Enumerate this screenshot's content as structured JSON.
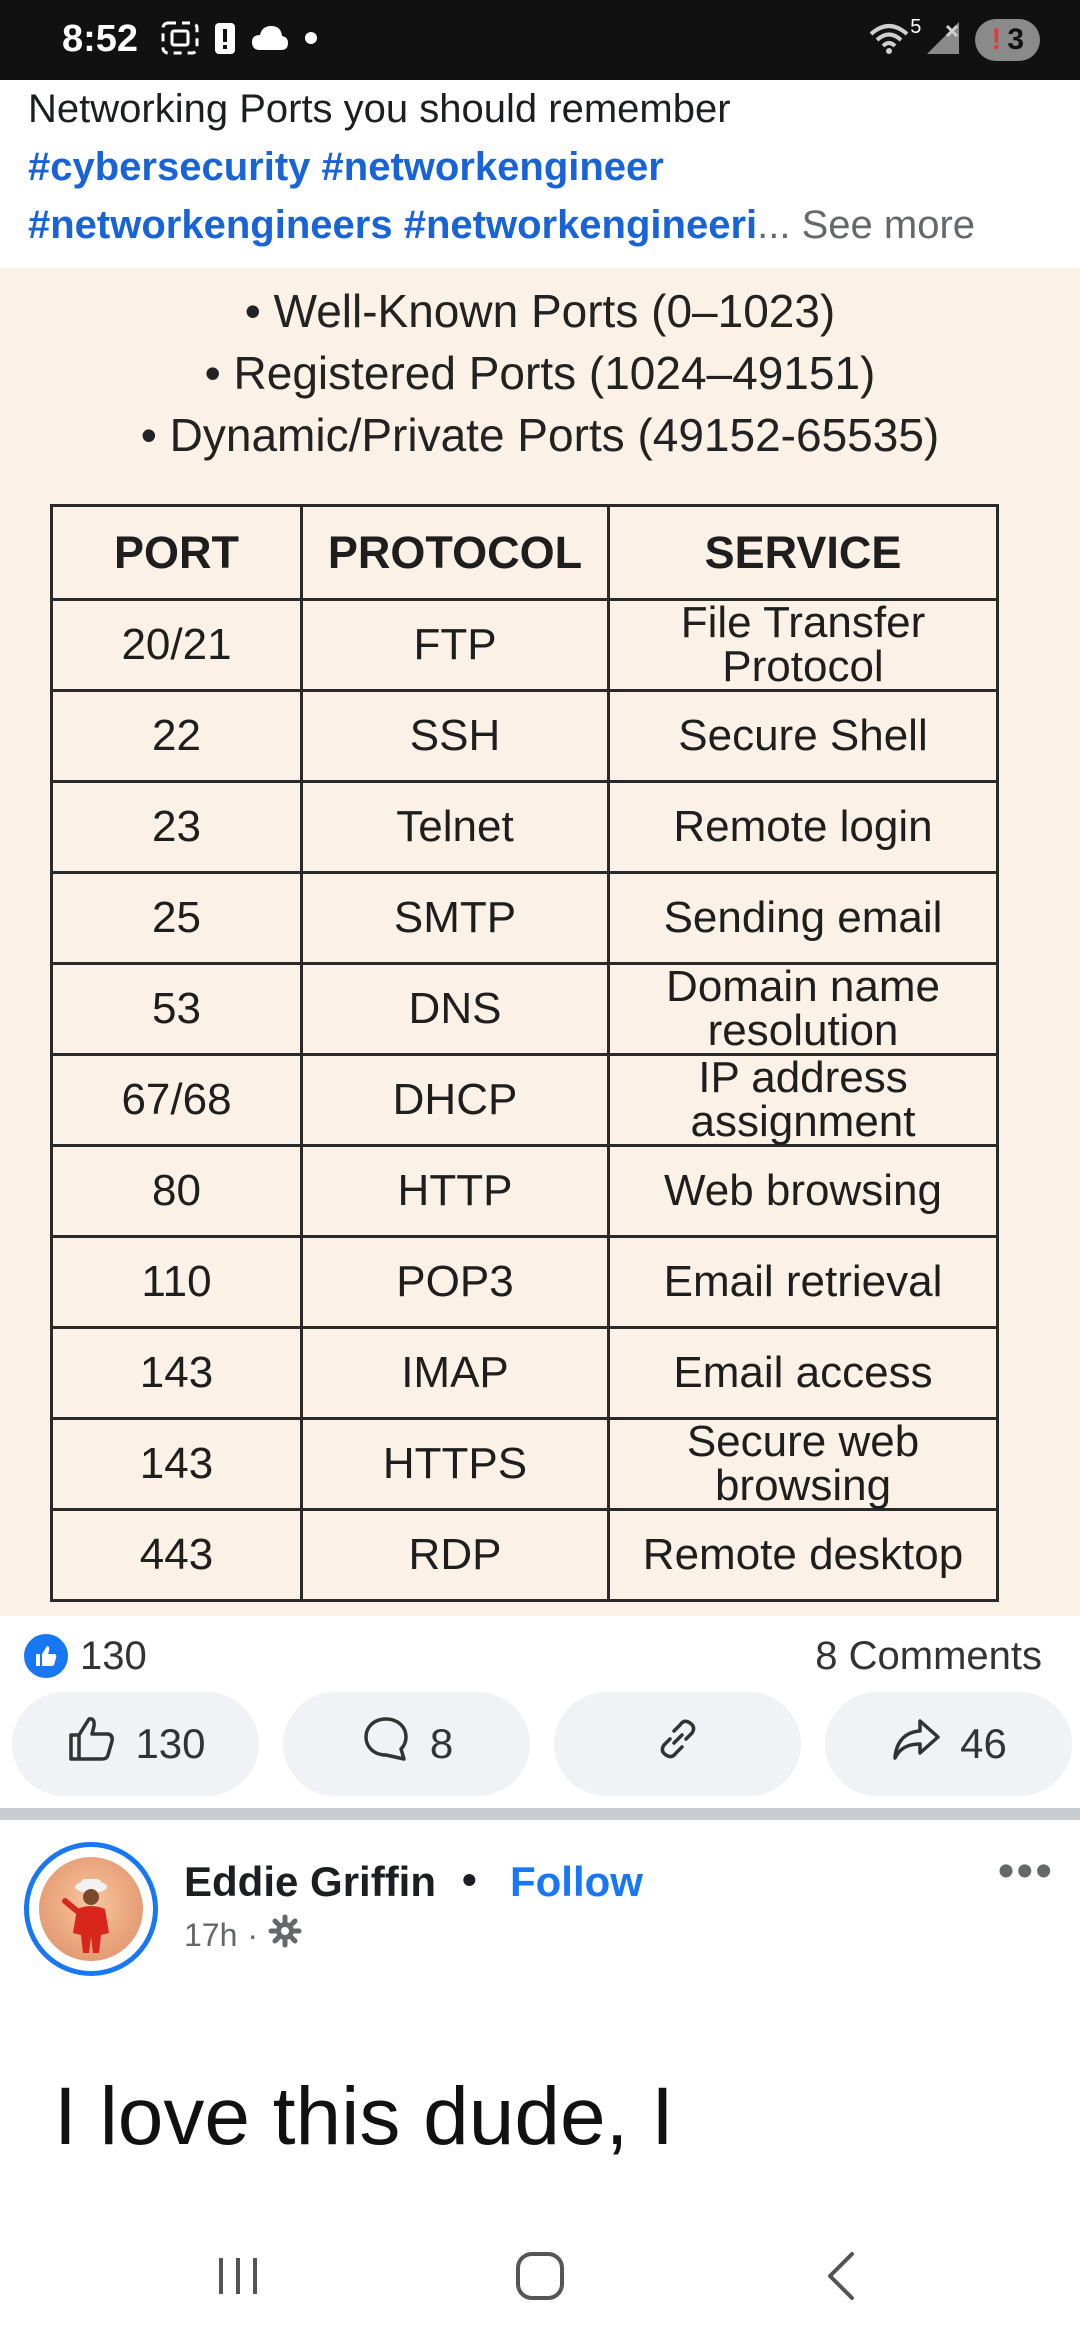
{
  "status_bar": {
    "time": "8:52",
    "network_superscript": "5",
    "badge_alert": "!",
    "badge_count": "3"
  },
  "post": {
    "caption_title": "Networking Ports you should remember",
    "hashtags_line1": [
      "#cybersecurity",
      "#networkengineer"
    ],
    "hashtags_line2": [
      "#networkengineers",
      "#networkengineeri"
    ],
    "ellipsis": "...",
    "see_more": "See more",
    "image": {
      "bullets": [
        "• Well-Known Ports (0–1023)",
        "• Registered Ports (1024–49151)",
        "• Dynamic/Private Ports (49152-65535)"
      ],
      "table": {
        "headers": [
          "PORT",
          "PROTOCOL",
          "SERVICE"
        ],
        "rows": [
          [
            "20/21",
            "FTP",
            "File Transfer Protocol"
          ],
          [
            "22",
            "SSH",
            "Secure Shell"
          ],
          [
            "23",
            "Telnet",
            "Remote login"
          ],
          [
            "25",
            "SMTP",
            "Sending email"
          ],
          [
            "53",
            "DNS",
            "Domain name resolution"
          ],
          [
            "67/68",
            "DHCP",
            "IP address assignment"
          ],
          [
            "80",
            "HTTP",
            "Web browsing"
          ],
          [
            "110",
            "POP3",
            "Email retrieval"
          ],
          [
            "143",
            "IMAP",
            "Email access"
          ],
          [
            "143",
            "HTTPS",
            "Secure web browsing"
          ],
          [
            "443",
            "RDP",
            "Remote desktop"
          ]
        ]
      }
    },
    "reactions": {
      "like_count": "130",
      "comments_label": "8 Comments"
    },
    "actions": {
      "like_count": "130",
      "comment_count": "8",
      "share_count": "46"
    }
  },
  "next_post": {
    "author": "Eddie Griffin",
    "separator": "•",
    "follow_label": "Follow",
    "time": "17h",
    "meta_separator": "·",
    "more": "•••",
    "text_line1": "I love this dude, I"
  },
  "colors": {
    "accent": "#1877f2",
    "hashtag": "#1863d6",
    "image_bg": "#fbf1e6"
  }
}
